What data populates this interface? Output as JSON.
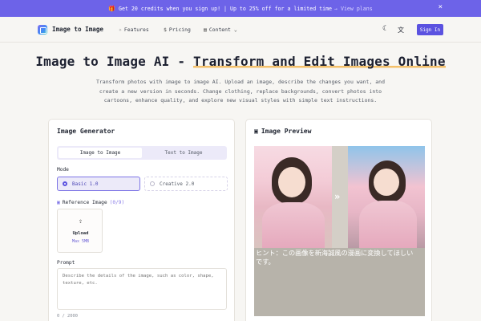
{
  "promo": {
    "text": "Get 20 credits when you sign up! | Up to 25% off for a limited time",
    "link": "→ View plans",
    "close": "×",
    "gift_icon": "gift-icon"
  },
  "nav": {
    "brand": "Image to Image",
    "features": "Features",
    "pricing": "Pricing",
    "content": "Content",
    "signin": "Sign In"
  },
  "hero": {
    "title_main": "Image to Image AI - ",
    "title_highlight": "Transform and Edit Images Online",
    "description": "Transform photos with image to image AI. Upload an image, describe the changes you want, and create a new version in seconds. Change clothing, replace backgrounds, convert photos into cartoons, enhance quality, and explore new visual styles with simple text instructions."
  },
  "generator": {
    "title": "Image Generator",
    "tabs": [
      {
        "label": "Image to Image",
        "active": true
      },
      {
        "label": "Text to Image",
        "active": false
      }
    ],
    "mode_label": "Mode",
    "modes": [
      {
        "label": "Basic 1.0",
        "selected": true
      },
      {
        "label": "Creative 2.0",
        "selected": false
      }
    ],
    "reference_label": "Reference Image",
    "reference_count": "(0/9)",
    "upload_label": "Upload",
    "upload_sub": "Max 5MB",
    "prompt_label": "Prompt",
    "prompt_placeholder": "Describe the details of the image, such as color, shape, texture, etc.",
    "char_count": "0 / 2000"
  },
  "preview": {
    "title": "Image Preview",
    "hint": "ヒント：この画像を新海誠風の漫画に変換してほしいです。"
  },
  "colors": {
    "accent": "#5b52e0",
    "banner": "#6d63e8",
    "highlight": "#f4c06a"
  }
}
